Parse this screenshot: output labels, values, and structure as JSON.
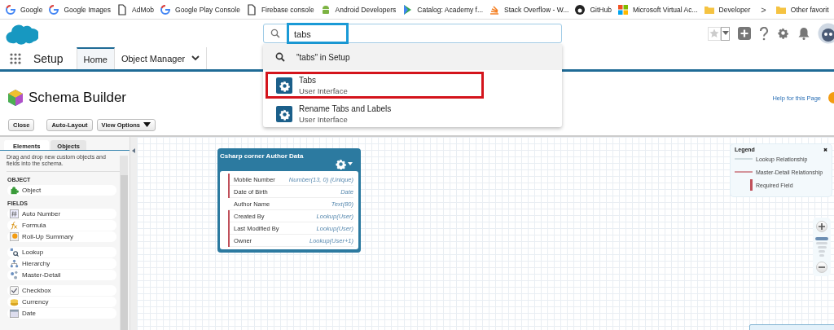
{
  "bookmarks": [
    "Google",
    "Google Images",
    "AdMob",
    "Google Play Console",
    "Firebase console",
    "Android Developers",
    "Catalog: Academy f...",
    "Stack Overflow - W...",
    "GitHub",
    "Microsoft Virtual Ac...",
    "Developer"
  ],
  "bookmarks_more": ">",
  "other_bookmarks": "Other favorit",
  "search": {
    "value": "tabs"
  },
  "search_dropdown": {
    "setup_search": "\"tabs\" in Setup",
    "results": [
      {
        "title": "Tabs",
        "subtitle": "User Interface",
        "selected": true
      },
      {
        "title": "Rename Tabs and Labels",
        "subtitle": "User Interface",
        "selected": false
      }
    ]
  },
  "nav": {
    "app": "Setup",
    "tabs": [
      {
        "label": "Home",
        "selected": true
      },
      {
        "label": "Object Manager",
        "selected": false
      }
    ]
  },
  "page": {
    "title": "Schema Builder",
    "help": "Help for this Page"
  },
  "toolbar": [
    "Close",
    "Auto-Layout",
    "View Options"
  ],
  "palette": {
    "tabs": [
      {
        "label": "Elements",
        "selected": true
      },
      {
        "label": "Objects",
        "selected": false
      }
    ],
    "description": "Drag and drop new custom objects and fields into the schema.",
    "sections": [
      {
        "heading": "OBJECT",
        "groups": [
          [
            "Object"
          ]
        ]
      },
      {
        "heading": "FIELDS",
        "groups": [
          [
            "Auto Number",
            "Formula",
            "Roll-Up Summary"
          ],
          [
            "Lookup",
            "Hierarchy",
            "Master-Detail"
          ],
          [
            "Checkbox",
            "Currency",
            "Date"
          ]
        ]
      }
    ]
  },
  "object_card": {
    "title": "Csharp corner Author Data",
    "fields": [
      {
        "name": "Mobile Number",
        "type": "Number(13, 0) (Unique)",
        "required": true
      },
      {
        "name": "Date of Birth",
        "type": "Date",
        "required": true
      },
      {
        "name": "Author Name",
        "type": "Text(80)",
        "required": false
      },
      {
        "name": "Created By",
        "type": "Lookup(User)",
        "required": true
      },
      {
        "name": "Last Modified By",
        "type": "Lookup(User)",
        "required": true
      },
      {
        "name": "Owner",
        "type": "Lookup(User+1)",
        "required": true
      }
    ]
  },
  "legend": {
    "title": "Legend",
    "close": "✖",
    "items": [
      {
        "kind": "lookup",
        "label": "Lookup Relationship"
      },
      {
        "kind": "master",
        "label": "Master-Detail Relationship"
      },
      {
        "kind": "required",
        "label": "Required Field"
      }
    ]
  },
  "zoom": {
    "level": 1
  }
}
